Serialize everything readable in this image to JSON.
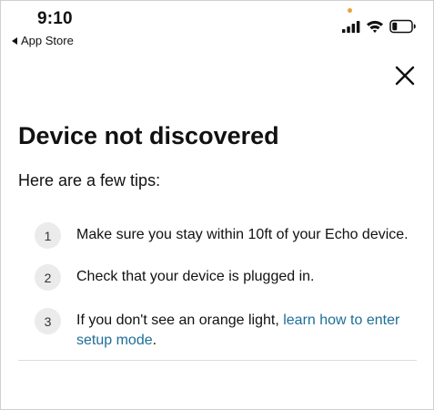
{
  "status_bar": {
    "time": "9:10",
    "back_label": "App Store",
    "orange_dot_color": "#e8a33c",
    "icons": [
      "cellular-signal-icon",
      "wifi-icon",
      "battery-icon"
    ]
  },
  "header": {
    "close_icon": "close-icon"
  },
  "main": {
    "title": "Device not discovered",
    "subtitle": "Here are a few tips:",
    "tips": [
      {
        "number": "1",
        "text": "Make sure you stay within 10ft of your Echo device."
      },
      {
        "number": "2",
        "text": "Check that your device is plugged in."
      },
      {
        "number": "3",
        "text_before_link": "If you don't see an orange light, ",
        "link_text": "learn how to enter setup mode",
        "text_after_link": "."
      }
    ]
  },
  "colors": {
    "link": "#1d6e98",
    "badge_background": "#ebebeb",
    "divider": "#dcdcdc"
  }
}
